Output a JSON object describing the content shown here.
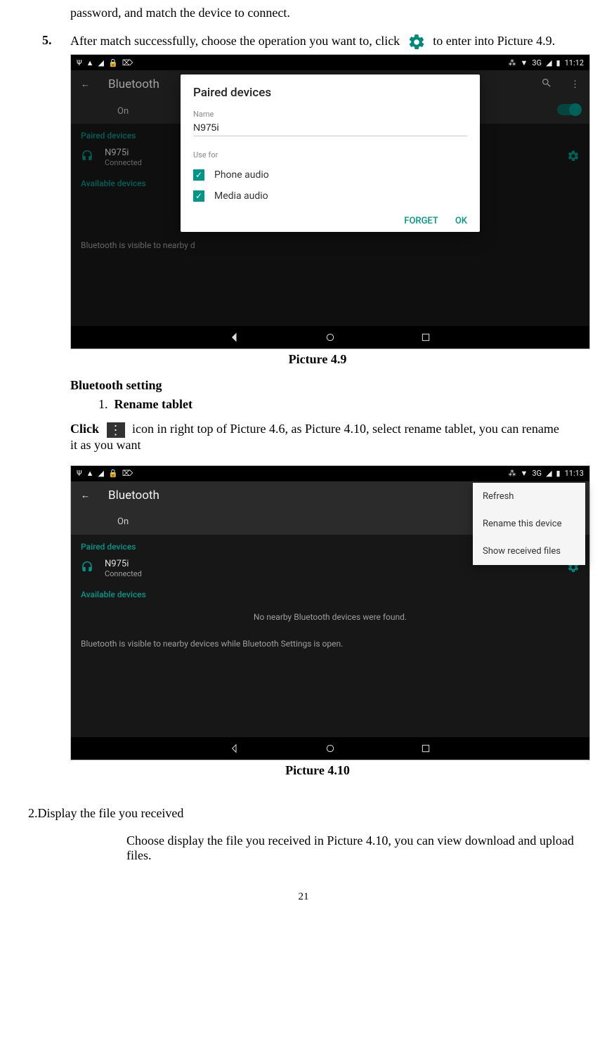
{
  "intro_line": "password, and match the device to connect.",
  "step5": {
    "num": "5.",
    "before": "After match successfully, choose the operation you want to, click",
    "after": "to enter into Picture 4.9."
  },
  "shot1": {
    "status_right": "3G",
    "time": "11:12",
    "title": "Bluetooth",
    "on": "On",
    "paired": "Paired devices",
    "device_name": "N975i",
    "device_status": "Connected",
    "available": "Available devices",
    "visible_note": "Bluetooth is visible to nearby d",
    "dialog": {
      "title": "Paired devices",
      "name_label": "Name",
      "name_value": "N975i",
      "use_for": "Use for",
      "opt_phone": "Phone audio",
      "opt_media": "Media audio",
      "forget": "FORGET",
      "ok": "OK"
    }
  },
  "caption1": "Picture 4.9",
  "bt_setting": "Bluetooth setting",
  "rename_num": "1.",
  "rename_label": "Rename tablet",
  "click_text": "Click",
  "after_click": "icon in right top of Picture 4.6, as Picture 4.10, select rename tablet, you can rename it as you want",
  "shot2": {
    "status_right": "3G",
    "time": "11:13",
    "title": "Bluetooth",
    "on": "On",
    "paired": "Paired devices",
    "device_name": "N975i",
    "device_status": "Connected",
    "available": "Available devices",
    "no_devices": "No nearby Bluetooth devices were found.",
    "visible_note": "Bluetooth is visible to nearby devices while Bluetooth Settings is open.",
    "menu": {
      "refresh": "Refresh",
      "rename": "Rename this device",
      "show": "Show received files"
    }
  },
  "caption2": "Picture 4.10",
  "display_heading": "2.Display the file you received",
  "display_body": "Choose display the file you received in Picture 4.10, you can view download and upload files.",
  "page_number": "21"
}
